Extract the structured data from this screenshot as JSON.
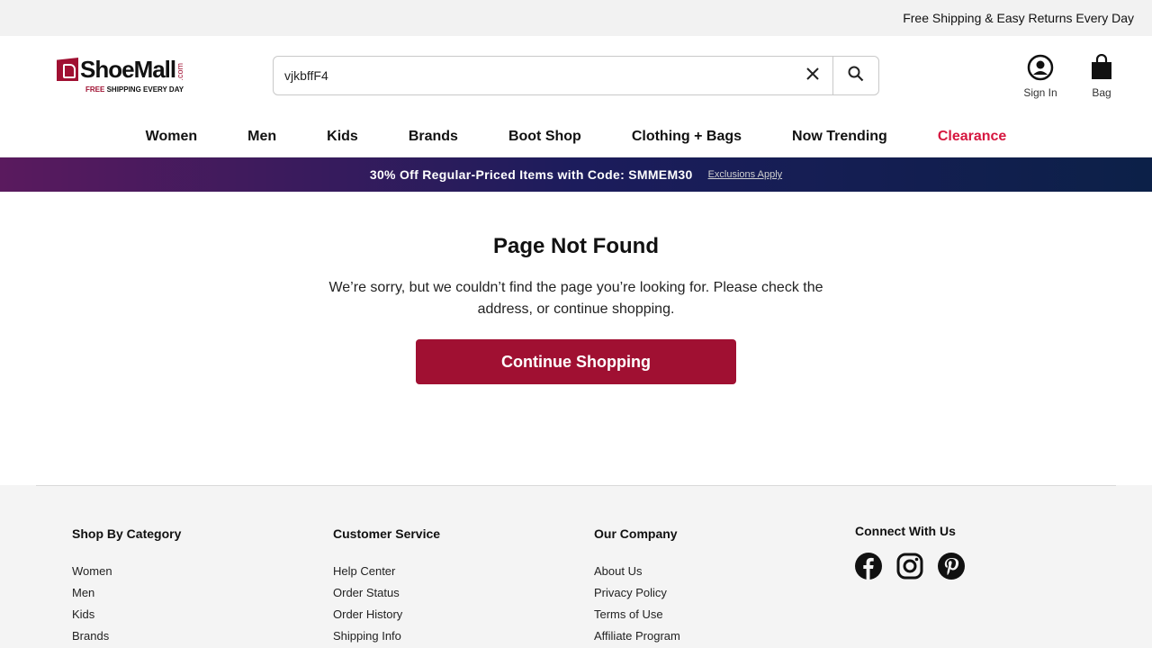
{
  "topbar": {
    "text": "Free Shipping & Easy Returns Every Day"
  },
  "logo": {
    "name": "ShoeMall",
    "suffix": ".com",
    "tag_prefix": "FREE",
    "tag_rest": "SHIPPING EVERY DAY"
  },
  "search": {
    "value": "vjkbffF4",
    "icons": {
      "clear": "close-icon",
      "submit": "search-icon"
    }
  },
  "account": {
    "sign_in": "Sign In",
    "bag": "Bag",
    "icons": {
      "sign_in": "user-circle-icon",
      "bag": "shopping-bag-icon"
    }
  },
  "nav": {
    "items": [
      "Women",
      "Men",
      "Kids",
      "Brands",
      "Boot Shop",
      "Clothing + Bags",
      "Now Trending",
      "Clearance"
    ]
  },
  "promo": {
    "text": "30% Off Regular-Priced Items with Code: SMMEM30",
    "link": "Exclusions Apply"
  },
  "not_found": {
    "title": "Page Not Found",
    "message": "We’re sorry, but we couldn’t find the page you’re looking for. Please check the address, or continue shopping.",
    "button": "Continue Shopping"
  },
  "footer": {
    "col1": {
      "title": "Shop By Category",
      "links": [
        "Women",
        "Men",
        "Kids",
        "Brands"
      ]
    },
    "col2": {
      "title": "Customer Service",
      "links": [
        "Help Center",
        "Order Status",
        "Order History",
        "Shipping Info"
      ]
    },
    "col3": {
      "title": "Our Company",
      "links": [
        "About Us",
        "Privacy Policy",
        "Terms of Use",
        "Affiliate Program"
      ]
    },
    "social": {
      "title": "Connect With Us",
      "icons": [
        "facebook-icon",
        "instagram-icon",
        "pinterest-icon"
      ]
    }
  },
  "colors": {
    "brand": "#a01032",
    "clearance": "#d6163f",
    "promo_start": "#5a1a5e",
    "promo_end": "#0c2048"
  }
}
